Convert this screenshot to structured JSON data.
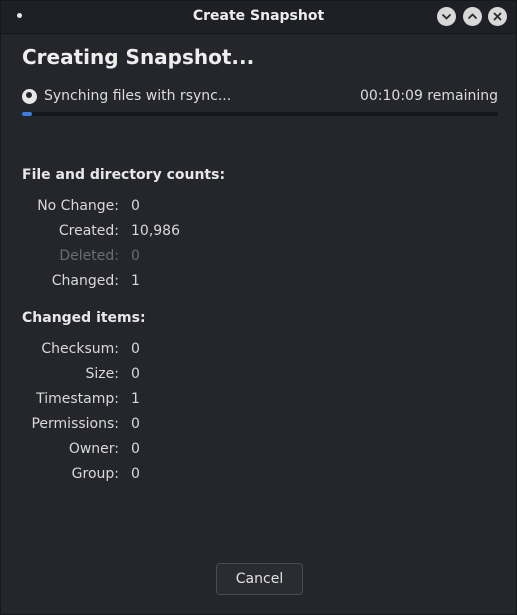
{
  "window": {
    "title": "Create Snapshot",
    "minimize_icon": "chevron-down-icon",
    "maximize_icon": "chevron-up-icon",
    "close_icon": "close-icon"
  },
  "main": {
    "heading": "Creating Snapshot...",
    "status": "Synching files with rsync...",
    "remaining": "00:10:09 remaining",
    "progress_fraction": 0.02,
    "accent_color": "#3d7de0"
  },
  "counts": {
    "heading": "File and directory counts:",
    "rows": [
      {
        "label": "No Change:",
        "value": "0",
        "dimmed": false
      },
      {
        "label": "Created:",
        "value": "10,986",
        "dimmed": false
      },
      {
        "label": "Deleted:",
        "value": "0",
        "dimmed": true
      },
      {
        "label": "Changed:",
        "value": "1",
        "dimmed": false
      }
    ]
  },
  "changed_items": {
    "heading": "Changed items:",
    "rows": [
      {
        "label": "Checksum:",
        "value": "0"
      },
      {
        "label": "Size:",
        "value": "0"
      },
      {
        "label": "Timestamp:",
        "value": "1"
      },
      {
        "label": "Permissions:",
        "value": "0"
      },
      {
        "label": "Owner:",
        "value": "0"
      },
      {
        "label": "Group:",
        "value": "0"
      }
    ]
  },
  "footer": {
    "cancel_label": "Cancel"
  }
}
